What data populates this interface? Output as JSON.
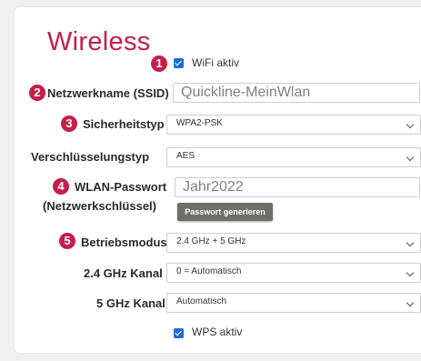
{
  "title": "Wireless",
  "badges": [
    "1",
    "2",
    "3",
    "4",
    "5"
  ],
  "wifi_active": {
    "label": "WiFi aktiv",
    "checked": true
  },
  "ssid": {
    "label": "Netzwerkname (SSID)",
    "value": "Quickline-MeinWlan"
  },
  "security_type": {
    "label": "Sicherheitstyp",
    "value": "WPA2-PSK"
  },
  "encryption_type": {
    "label": "Verschlüsselungstyp",
    "value": "AES"
  },
  "wlan_password": {
    "label_line1": "WLAN-Passwort",
    "label_line2": "(Netzwerkschlüssel)",
    "value": "Jahr2022",
    "generate_button": "Passwort generieren"
  },
  "operating_mode": {
    "label": "Betriebsmodus",
    "value": "2.4 GHz + 5 GHz"
  },
  "channel_24": {
    "label": "2.4 GHz Kanal",
    "value": "0 = Automatisch"
  },
  "channel_5": {
    "label": "5 GHz Kanal",
    "value": "Automatisch"
  },
  "wps_active": {
    "label": "WPS aktiv",
    "checked": true
  },
  "icons": {
    "badge": "number-badge-icon",
    "checkbox": "checkbox-checked-icon",
    "dropdown": "chevron-down-icon"
  },
  "colors": {
    "accent": "#c41e49",
    "checkbox": "#1d6fd8",
    "button": "#6f6f6a",
    "background": "#f1f1f1"
  }
}
